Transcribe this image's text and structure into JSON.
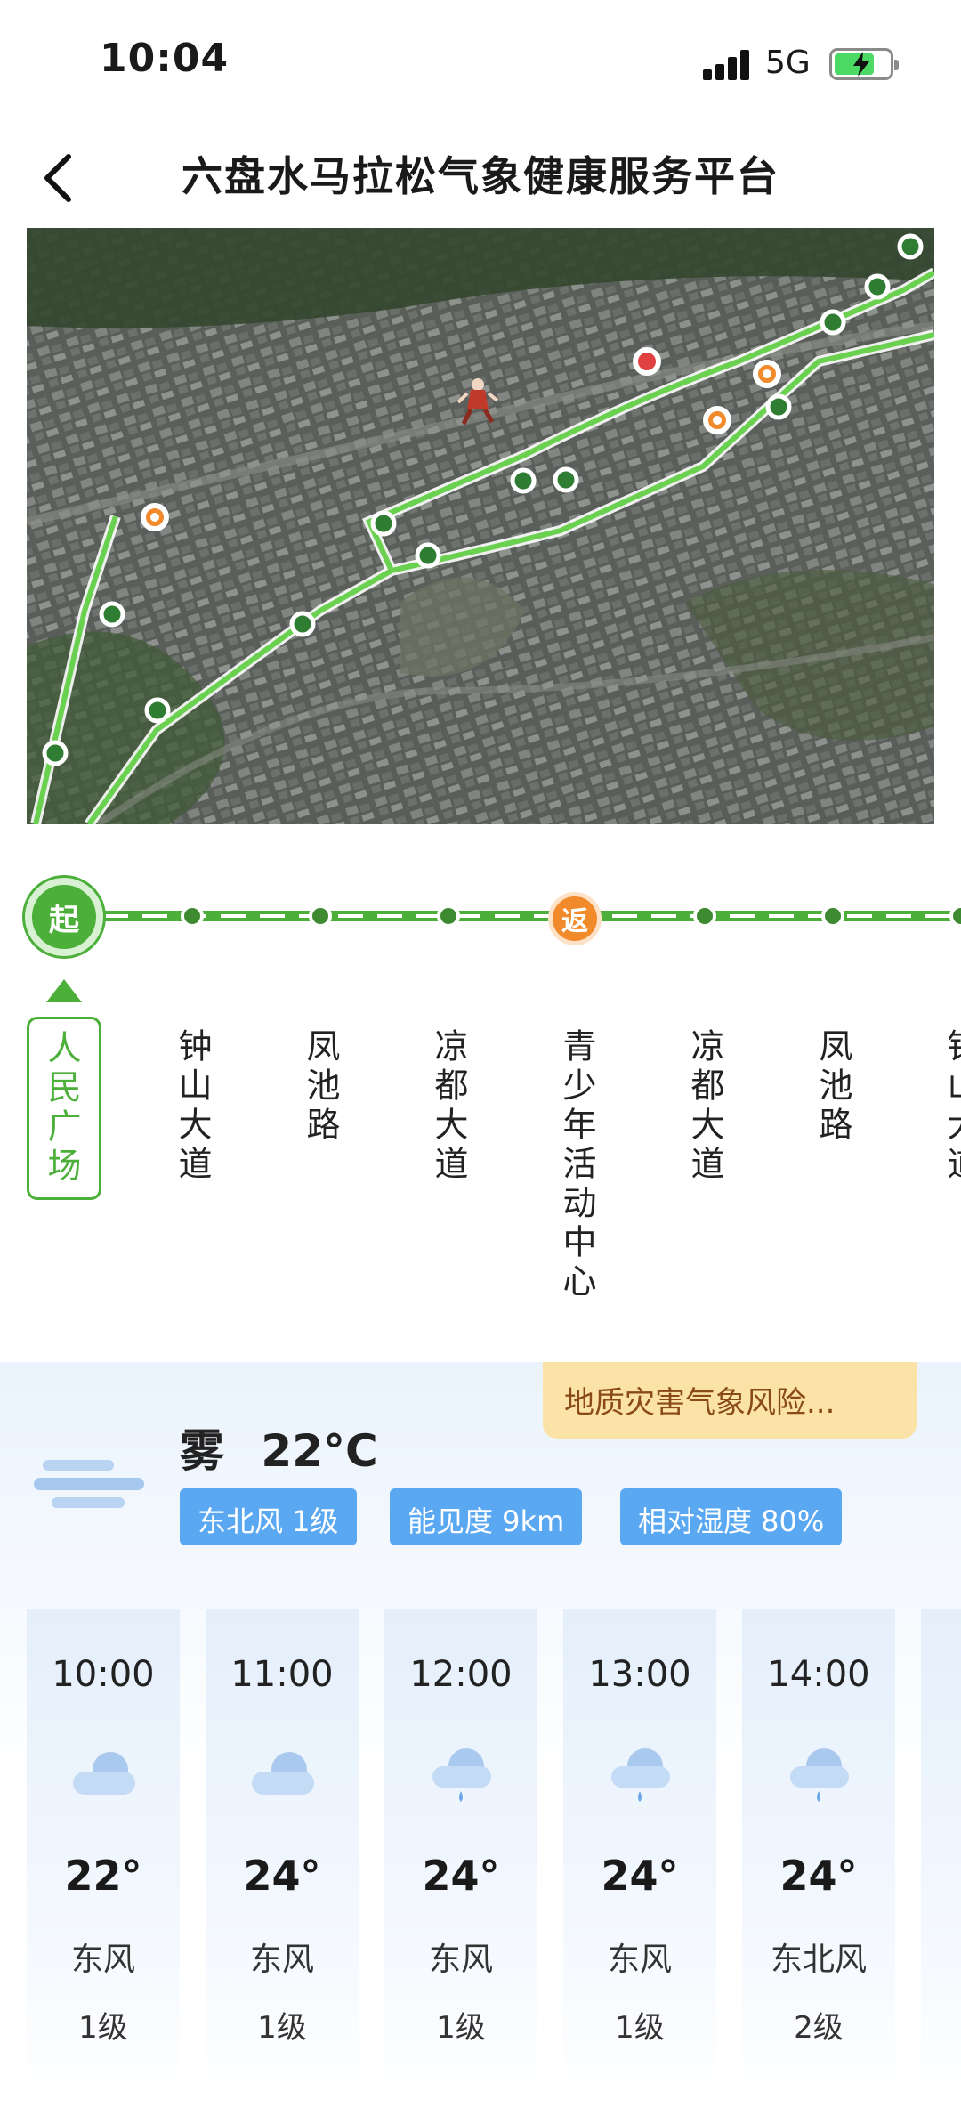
{
  "status_bar": {
    "time": "10:04",
    "network": "5G"
  },
  "header": {
    "title": "六盘水马拉松气象健康服务平台"
  },
  "route": {
    "start_badge": "起",
    "return_badge": "返",
    "stops": [
      "人民广场",
      "钟山大道",
      "凤池路",
      "凉都大道",
      "青少年活动中心",
      "凉都大道",
      "凤池路",
      "钟山大道"
    ]
  },
  "weather": {
    "risk_tag": "地质灾害气象风险...",
    "condition": "雾",
    "temperature": "22°C",
    "chips": {
      "wind": "东北风 1级",
      "visibility": "能见度 9km",
      "humidity": "相对湿度 80%"
    },
    "hourly": [
      {
        "time": "10:00",
        "icon": "cloudy-icon",
        "temp": "22°",
        "wind": "东风",
        "level": "1级"
      },
      {
        "time": "11:00",
        "icon": "cloudy-icon",
        "temp": "24°",
        "wind": "东风",
        "level": "1级"
      },
      {
        "time": "12:00",
        "icon": "light-rain-icon",
        "temp": "24°",
        "wind": "东风",
        "level": "1级"
      },
      {
        "time": "13:00",
        "icon": "light-rain-icon",
        "temp": "24°",
        "wind": "东风",
        "level": "1级"
      },
      {
        "time": "14:00",
        "icon": "light-rain-icon",
        "temp": "24°",
        "wind": "东北风",
        "level": "2级"
      }
    ]
  },
  "colors": {
    "route_green": "#4caf3a",
    "return_orange": "#f08a2a",
    "chip_blue": "#5aa8f2",
    "risk_yellow": "#fbe3a8"
  }
}
